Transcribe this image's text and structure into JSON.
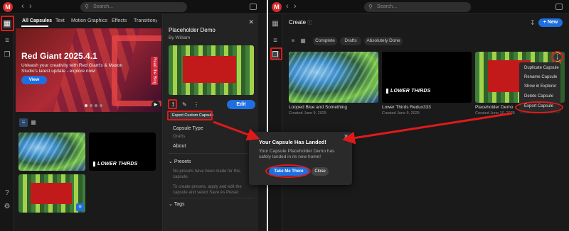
{
  "left": {
    "search_placeholder": "Search...",
    "tabs": [
      "All Capsules",
      "Text",
      "Motion Graphics",
      "Effects",
      "Transition"
    ],
    "hero": {
      "title": "Red Giant 2025.4.1",
      "subtitle": "Unleash your creativity with Red Giant's & Maxon Studio's latest update - explore now!",
      "view_label": "View",
      "vertical_tag": "Read the Blog"
    },
    "tiles": {
      "lower_thirds": "LOWER THIRDS"
    },
    "panel": {
      "title": "Placeholder Demo",
      "by": "By William",
      "edit_label": "Edit",
      "export_tip": "Export Custom Capsule",
      "capsule_type_label": "Capsule Type",
      "capsule_type_value": "Drafts",
      "about_label": "About",
      "presets_label": "Presets",
      "presets_note": "No presets have been made for this capsule.",
      "presets_hint": "To create presets, apply and edit the capsule and select Save As Preset",
      "tags_label": "Tags"
    },
    "rail": {
      "help": "?"
    }
  },
  "right": {
    "search_placeholder": "Search...",
    "create_label": "Create",
    "new_label": "+ New",
    "filters": [
      "Complete",
      "Drafts",
      "Absolutely Done"
    ],
    "cards": [
      {
        "name": "Looped Blue and Something",
        "date": "Created June 9, 2025"
      },
      {
        "name": "Lower Thirds Redux333",
        "date": "Created June 9, 2025"
      },
      {
        "name": "Placeholder Demo",
        "date": "Created June 10, 2025"
      }
    ],
    "card_lower_thirds": "LOWER THIRDS",
    "menu_items": [
      "Duplicate Capsule",
      "Rename Capsule",
      "Show in Explorer",
      "Delete Capsule",
      "Export Capsule"
    ]
  },
  "dialog": {
    "title": "Your Capsule Has Landed!",
    "body": "Your Capsule Placeholder Demo has safely landed in its new home!",
    "primary": "Take Me There",
    "secondary": "Close"
  },
  "colors": {
    "accent": "#1f6fe0",
    "annotation_red": "#e01a1a",
    "brand_red": "#d62a2a"
  }
}
